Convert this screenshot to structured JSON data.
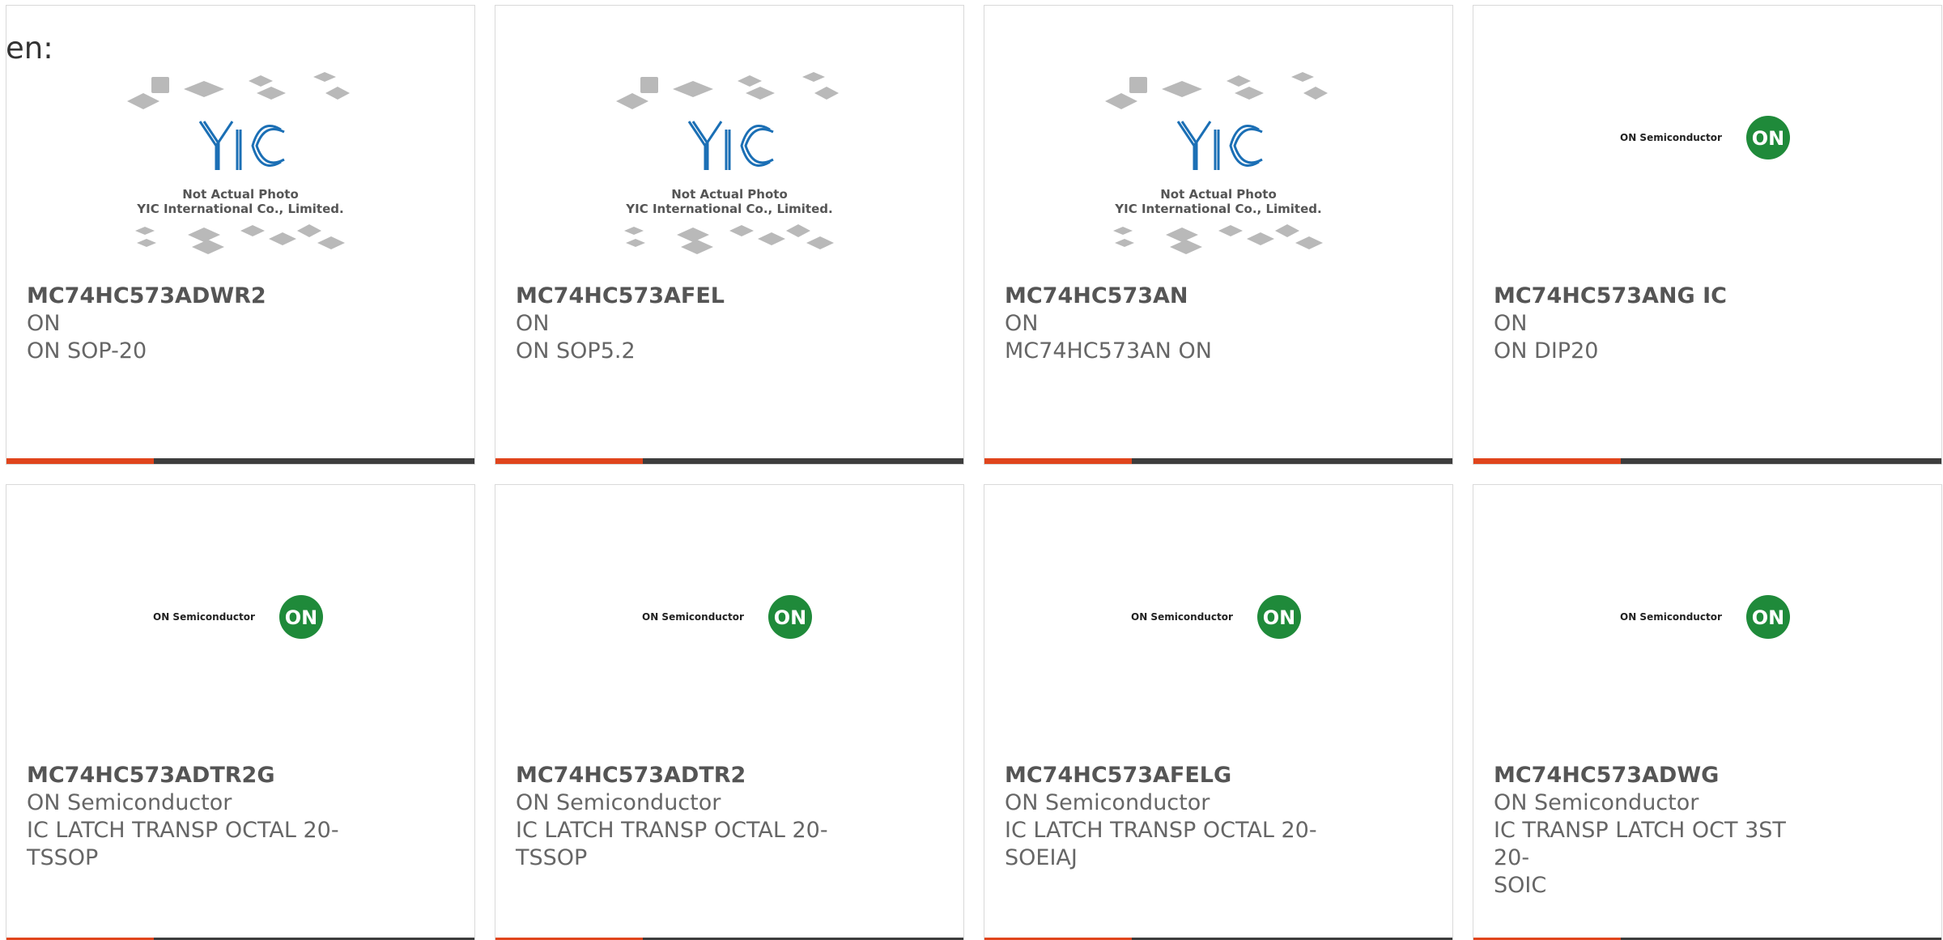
{
  "lang_label": "en:",
  "placeholder_image": {
    "line1": "Not Actual Photo",
    "line2": "YIC International Co., Limited.",
    "brand": "YIC"
  },
  "on_logo": {
    "wordmark": "ON Semiconductor",
    "badge": "ON"
  },
  "colors": {
    "accent": "#e0451c",
    "bar": "#3d3d3d",
    "on_green": "#1f8a3a",
    "yic_blue": "#1b6fb5"
  },
  "products": [
    {
      "title": "MC74HC573ADWR2",
      "line1": "ON",
      "line2": "ON SOP-20",
      "line3": "",
      "image": "yic-placeholder"
    },
    {
      "title": "MC74HC573AFEL",
      "line1": "ON",
      "line2": "ON SOP5.2",
      "line3": "",
      "image": "yic-placeholder"
    },
    {
      "title": "MC74HC573AN",
      "line1": "ON",
      "line2": "MC74HC573AN ON",
      "line3": "",
      "image": "yic-placeholder"
    },
    {
      "title": "MC74HC573ANG IC",
      "line1": "ON",
      "line2": "ON DIP20",
      "line3": "",
      "image": "on-semiconductor-logo"
    },
    {
      "title": "MC74HC573ADTR2G",
      "line1": "ON Semiconductor",
      "line2": "IC LATCH TRANSP OCTAL 20-",
      "line3": "TSSOP",
      "image": "on-semiconductor-logo"
    },
    {
      "title": "MC74HC573ADTR2",
      "line1": "ON Semiconductor",
      "line2": "IC LATCH TRANSP OCTAL 20-",
      "line3": "TSSOP",
      "image": "on-semiconductor-logo"
    },
    {
      "title": "MC74HC573AFELG",
      "line1": "ON Semiconductor",
      "line2": "IC LATCH TRANSP OCTAL 20-",
      "line3": "SOEIAJ",
      "image": "on-semiconductor-logo"
    },
    {
      "title": "MC74HC573ADWG",
      "line1": "ON Semiconductor",
      "line2": "IC TRANSP LATCH OCT 3ST 20-",
      "line3": "SOIC",
      "image": "on-semiconductor-logo"
    }
  ]
}
